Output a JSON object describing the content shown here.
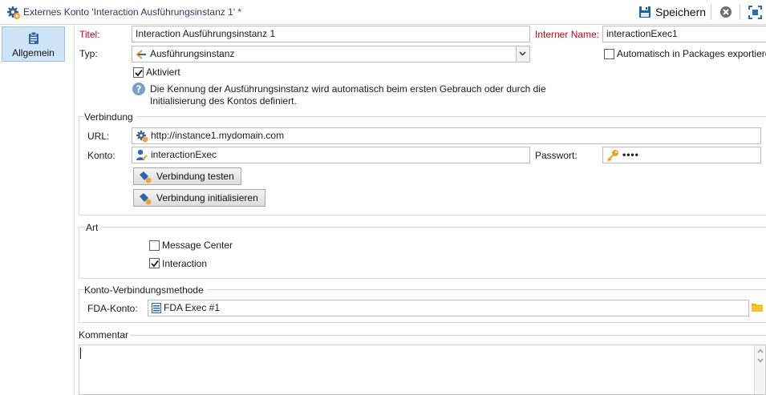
{
  "window": {
    "title": "Externes Konto 'Interaction Ausführungsinstanz 1' *",
    "save_label": "Speichern"
  },
  "sidebar": {
    "tabs": [
      {
        "label": "Allgemein",
        "active": true
      }
    ]
  },
  "form": {
    "title_label": "Titel:",
    "title_value": "Interaction Ausführungsinstanz 1",
    "internal_name_label": "Interner Name:",
    "internal_name_value": "interactionExec1",
    "type_label": "Typ:",
    "type_value": "Ausführungsinstanz",
    "export_label": "Automatisch in Packages exportieren",
    "export_checked": false,
    "active_label": "Aktiviert",
    "active_checked": true,
    "info_line1": "Die Kennung der Ausführungsinstanz wird automatisch beim ersten Gebrauch oder durch die",
    "info_line2": "Initialisierung des Kontos definiert."
  },
  "connection": {
    "section_title": "Verbindung",
    "url_label": "URL:",
    "url_value": "http://instance1.mydomain.com",
    "account_label": "Konto:",
    "account_value": "interactionExec",
    "password_label": "Passwort:",
    "password_value": "••••",
    "test_button": "Verbindung testen",
    "init_button": "Verbindung initialisieren"
  },
  "kind": {
    "section_title": "Art",
    "options": [
      {
        "label": "Message Center",
        "checked": false
      },
      {
        "label": "Interaction",
        "checked": true
      }
    ]
  },
  "connection_method": {
    "section_title": "Konto-Verbindungsmethode",
    "fda_label": "FDA-Konto:",
    "fda_value": "FDA Exec #1"
  },
  "comment": {
    "label": "Kommentar",
    "value": ""
  },
  "colors": {
    "required_label": "#d0021b",
    "tab_active_bg": "#cfe4f7",
    "accent_blue": "#1f6fc5",
    "key_icon": "#e8a317"
  },
  "icons": [
    "gear-account-icon",
    "save-icon",
    "cancel-icon",
    "maximize-icon",
    "clipboard-icon",
    "arrow-left-icon",
    "info-icon",
    "gear-url-icon",
    "user-icon",
    "key-icon",
    "plug-icon",
    "list-icon",
    "folder-icon"
  ]
}
